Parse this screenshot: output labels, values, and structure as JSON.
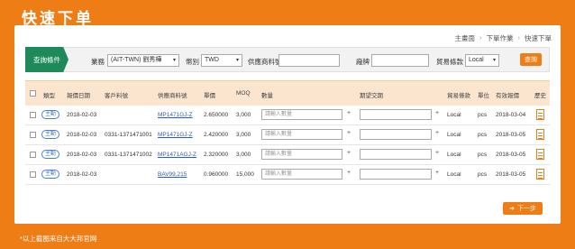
{
  "page_title": "快速下单",
  "breadcrumb": [
    "主畫面",
    "下單作業",
    "快速下單"
  ],
  "filter": {
    "tab_label": "查詢條件",
    "business_label": "業務",
    "business_value": "(AIT-TWN) 劉秀樺",
    "currency_label": "幣別",
    "currency_value": "TWD",
    "supplier_part_label": "供應商料號",
    "vendor_label": "廠牌",
    "trade_terms_label": "貿易條款",
    "trade_terms_value": "Local",
    "search_label": "查詢"
  },
  "table": {
    "headers": {
      "type": "類型",
      "quote_date": "報價日期",
      "customer_part": "客戶料號",
      "supplier_part": "供應商料號",
      "unit_price": "單價",
      "moq": "MOQ",
      "quantity": "數量",
      "expected_date": "期望交期",
      "trade_terms": "貿易條款",
      "unit": "單位",
      "valid_date": "有效報價",
      "history": "歷史"
    },
    "rows": [
      {
        "type": "主動",
        "quote_date": "2018-02-03",
        "customer_part": "",
        "supplier_part": "MP1471GJ-Z",
        "unit_price": "2.650000",
        "moq": "3,000",
        "qty_placeholder": "請輸入數量",
        "trade_terms": "Local",
        "unit": "pcs",
        "valid_date": "2018-03-04"
      },
      {
        "type": "主動",
        "quote_date": "2018-02-03",
        "customer_part": "0331-1371471001",
        "supplier_part": "MP1471GJ-Z",
        "unit_price": "2.420000",
        "moq": "3,000",
        "qty_placeholder": "請輸入數量",
        "trade_terms": "Local",
        "unit": "pcs",
        "valid_date": "2018-03-05"
      },
      {
        "type": "主動",
        "quote_date": "2018-02-03",
        "customer_part": "0331-1371471002",
        "supplier_part": "MP1471AGJ-Z",
        "unit_price": "2.320000",
        "moq": "3,000",
        "qty_placeholder": "請輸入數量",
        "trade_terms": "Local",
        "unit": "pcs",
        "valid_date": "2018-03-05"
      },
      {
        "type": "主動",
        "quote_date": "2018-02-03",
        "customer_part": "",
        "supplier_part": "BAV99,215",
        "unit_price": "0.960000",
        "moq": "15,000",
        "qty_placeholder": "請輸入數量",
        "trade_terms": "Local",
        "unit": "pcs",
        "valid_date": "2018-03-05"
      }
    ]
  },
  "next_button": "下一步",
  "footnote": "*以上截图来自大大邦官网",
  "colors": {
    "brand_orange": "#ee7d16",
    "tab_green": "#1e8a5a",
    "header_bg": "#fbe5cf",
    "link_blue": "#2d5fb3"
  }
}
